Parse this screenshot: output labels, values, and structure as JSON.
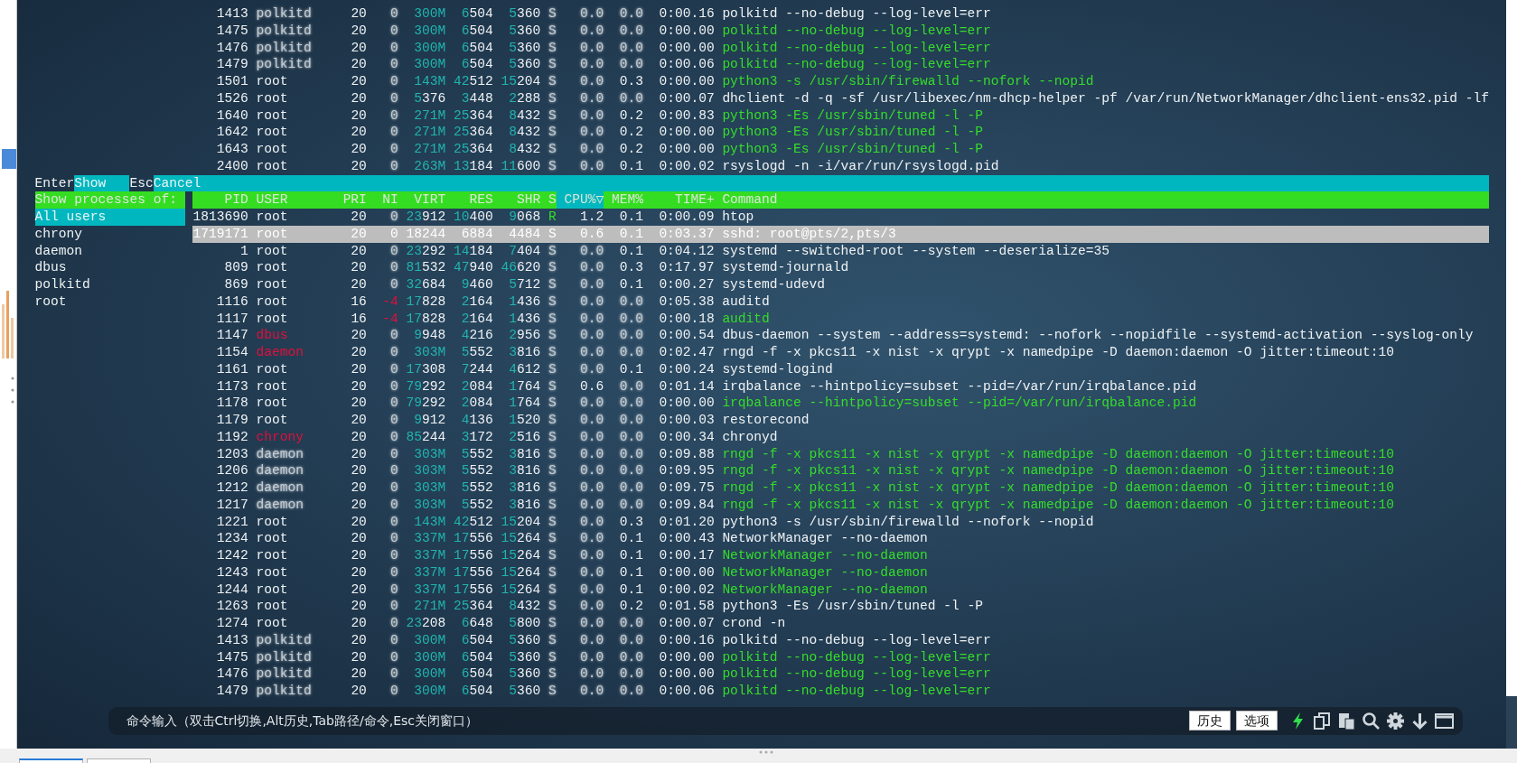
{
  "terminal": {
    "background_rows": [
      {
        "pid": "1413",
        "user": "polkitd",
        "kind": "dim",
        "pri": "20",
        "ni": "0",
        "virt": "300M",
        "res": "6504",
        "shr": "5360",
        "state": "S",
        "cpu": "0.0",
        "mem": "0.0",
        "time": "0:00.16",
        "command": "polkitd --no-debug --log-level=err",
        "thread": false
      },
      {
        "pid": "1475",
        "user": "polkitd",
        "kind": "dim",
        "pri": "20",
        "ni": "0",
        "virt": "300M",
        "res": "6504",
        "shr": "5360",
        "state": "S",
        "cpu": "0.0",
        "mem": "0.0",
        "time": "0:00.00",
        "command": "polkitd --no-debug --log-level=err",
        "thread": true
      },
      {
        "pid": "1476",
        "user": "polkitd",
        "kind": "dim",
        "pri": "20",
        "ni": "0",
        "virt": "300M",
        "res": "6504",
        "shr": "5360",
        "state": "S",
        "cpu": "0.0",
        "mem": "0.0",
        "time": "0:00.00",
        "command": "polkitd --no-debug --log-level=err",
        "thread": true
      },
      {
        "pid": "1479",
        "user": "polkitd",
        "kind": "dim",
        "pri": "20",
        "ni": "0",
        "virt": "300M",
        "res": "6504",
        "shr": "5360",
        "state": "S",
        "cpu": "0.0",
        "mem": "0.0",
        "time": "0:00.06",
        "command": "polkitd --no-debug --log-level=err",
        "thread": true
      },
      {
        "pid": "1501",
        "user": "root",
        "kind": "plain",
        "pri": "20",
        "ni": "0",
        "virt": "143M",
        "res": "42512",
        "shr": "15204",
        "state": "S",
        "cpu": "0.0",
        "mem": "0.3",
        "time": "0:00.00",
        "command": "python3 -s /usr/sbin/firewalld --nofork --nopid",
        "thread": true
      },
      {
        "pid": "1526",
        "user": "root",
        "kind": "plain",
        "pri": "20",
        "ni": "0",
        "virt": "5376",
        "res": "3448",
        "shr": "2288",
        "state": "S",
        "cpu": "0.0",
        "mem": "0.0",
        "time": "0:00.07",
        "command": "dhclient -d -q -sf /usr/libexec/nm-dhcp-helper -pf /var/run/NetworkManager/dhclient-ens32.pid -lf",
        "thread": false
      },
      {
        "pid": "1640",
        "user": "root",
        "kind": "plain",
        "pri": "20",
        "ni": "0",
        "virt": "271M",
        "res": "25364",
        "shr": "8432",
        "state": "S",
        "cpu": "0.0",
        "mem": "0.2",
        "time": "0:00.83",
        "command": "python3 -Es /usr/sbin/tuned -l -P",
        "thread": true
      },
      {
        "pid": "1642",
        "user": "root",
        "kind": "plain",
        "pri": "20",
        "ni": "0",
        "virt": "271M",
        "res": "25364",
        "shr": "8432",
        "state": "S",
        "cpu": "0.0",
        "mem": "0.2",
        "time": "0:00.00",
        "command": "python3 -Es /usr/sbin/tuned -l -P",
        "thread": true
      },
      {
        "pid": "1643",
        "user": "root",
        "kind": "plain",
        "pri": "20",
        "ni": "0",
        "virt": "271M",
        "res": "25364",
        "shr": "8432",
        "state": "S",
        "cpu": "0.0",
        "mem": "0.2",
        "time": "0:00.00",
        "command": "python3 -Es /usr/sbin/tuned -l -P",
        "thread": true
      },
      {
        "pid": "2400",
        "user": "root",
        "kind": "plain",
        "pri": "20",
        "ni": "0",
        "virt": "263M",
        "res": "13184",
        "shr": "11600",
        "state": "S",
        "cpu": "0.0",
        "mem": "0.1",
        "time": "0:00.02",
        "command": "rsyslogd -n -i/var/run/rsyslogd.pid",
        "thread": false
      }
    ],
    "function_bar": [
      {
        "key": "Enter",
        "label": "Show"
      },
      {
        "key": "Esc",
        "label": "Cancel"
      }
    ],
    "user_filter": {
      "title": "Show processes of:",
      "options": [
        {
          "label": "All users",
          "selected": true
        },
        {
          "label": "chrony",
          "selected": false
        },
        {
          "label": "daemon",
          "selected": false
        },
        {
          "label": "dbus",
          "selected": false
        },
        {
          "label": "polkitd",
          "selected": false
        },
        {
          "label": "root",
          "selected": false
        }
      ]
    },
    "process_table": {
      "columns": [
        {
          "label": "PID",
          "sorted": false
        },
        {
          "label": "USER",
          "sorted": false
        },
        {
          "label": "PRI",
          "sorted": false
        },
        {
          "label": "NI",
          "sorted": false
        },
        {
          "label": "VIRT",
          "sorted": false
        },
        {
          "label": "RES",
          "sorted": false
        },
        {
          "label": "SHR",
          "sorted": false
        },
        {
          "label": "S",
          "sorted": false
        },
        {
          "label": "CPU%▽",
          "sorted": true
        },
        {
          "label": "MEM%",
          "sorted": false
        },
        {
          "label": "TIME+",
          "sorted": false
        },
        {
          "label": "Command",
          "sorted": false
        }
      ],
      "rows": [
        {
          "pid": "1813690",
          "user": "root",
          "kind": "plain",
          "pri": "20",
          "ni": "0",
          "virt": "23912",
          "res": "10400",
          "shr": "9068",
          "state": "R",
          "cpu": "1.2",
          "mem": "0.1",
          "time": "0:00.09",
          "command": "htop",
          "thread": false,
          "selected": false
        },
        {
          "pid": "1719171",
          "user": "root",
          "kind": "plain",
          "pri": "20",
          "ni": "0",
          "virt": "18244",
          "res": "6884",
          "shr": "4484",
          "state": "S",
          "cpu": "0.6",
          "mem": "0.1",
          "time": "0:03.37",
          "command": "sshd: root@pts/2,pts/3",
          "thread": false,
          "selected": true
        },
        {
          "pid": "1",
          "user": "root",
          "kind": "plain",
          "pri": "20",
          "ni": "0",
          "virt": "23292",
          "res": "14184",
          "shr": "7404",
          "state": "S",
          "cpu": "0.0",
          "mem": "0.1",
          "time": "0:04.12",
          "command": "systemd --switched-root --system --deserialize=35",
          "thread": false,
          "selected": false
        },
        {
          "pid": "809",
          "user": "root",
          "kind": "plain",
          "pri": "20",
          "ni": "0",
          "virt": "81532",
          "res": "47940",
          "shr": "46620",
          "state": "S",
          "cpu": "0.0",
          "mem": "0.3",
          "time": "0:17.97",
          "command": "systemd-journald",
          "thread": false,
          "selected": false
        },
        {
          "pid": "869",
          "user": "root",
          "kind": "plain",
          "pri": "20",
          "ni": "0",
          "virt": "32684",
          "res": "9460",
          "shr": "5712",
          "state": "S",
          "cpu": "0.0",
          "mem": "0.1",
          "time": "0:00.27",
          "command": "systemd-udevd",
          "thread": false,
          "selected": false
        },
        {
          "pid": "1116",
          "user": "root",
          "kind": "plain",
          "pri": "16",
          "ni": "-4",
          "virt": "17828",
          "res": "2164",
          "shr": "1436",
          "state": "S",
          "cpu": "0.0",
          "mem": "0.0",
          "time": "0:05.38",
          "command": "auditd",
          "thread": false,
          "selected": false
        },
        {
          "pid": "1117",
          "user": "root",
          "kind": "plain",
          "pri": "16",
          "ni": "-4",
          "virt": "17828",
          "res": "2164",
          "shr": "1436",
          "state": "S",
          "cpu": "0.0",
          "mem": "0.0",
          "time": "0:00.18",
          "command": "auditd",
          "thread": true,
          "selected": false
        },
        {
          "pid": "1147",
          "user": "dbus",
          "kind": "alert",
          "pri": "20",
          "ni": "0",
          "virt": "9948",
          "res": "4216",
          "shr": "2956",
          "state": "S",
          "cpu": "0.0",
          "mem": "0.0",
          "time": "0:00.54",
          "command": "dbus-daemon --system --address=systemd: --nofork --nopidfile --systemd-activation --syslog-only",
          "thread": false,
          "selected": false
        },
        {
          "pid": "1154",
          "user": "daemon",
          "kind": "alert",
          "pri": "20",
          "ni": "0",
          "virt": "303M",
          "res": "5552",
          "shr": "3816",
          "state": "S",
          "cpu": "0.0",
          "mem": "0.0",
          "time": "0:02.47",
          "command": "rngd -f -x pkcs11 -x nist -x qrypt -x namedpipe -D daemon:daemon -O jitter:timeout:10",
          "thread": false,
          "selected": false
        },
        {
          "pid": "1161",
          "user": "root",
          "kind": "plain",
          "pri": "20",
          "ni": "0",
          "virt": "17308",
          "res": "7244",
          "shr": "4612",
          "state": "S",
          "cpu": "0.0",
          "mem": "0.1",
          "time": "0:00.24",
          "command": "systemd-logind",
          "thread": false,
          "selected": false
        },
        {
          "pid": "1173",
          "user": "root",
          "kind": "plain",
          "pri": "20",
          "ni": "0",
          "virt": "79292",
          "res": "2084",
          "shr": "1764",
          "state": "S",
          "cpu": "0.6",
          "mem": "0.0",
          "time": "0:01.14",
          "command": "irqbalance --hintpolicy=subset --pid=/var/run/irqbalance.pid",
          "thread": false,
          "selected": false
        },
        {
          "pid": "1178",
          "user": "root",
          "kind": "plain",
          "pri": "20",
          "ni": "0",
          "virt": "79292",
          "res": "2084",
          "shr": "1764",
          "state": "S",
          "cpu": "0.0",
          "mem": "0.0",
          "time": "0:00.00",
          "command": "irqbalance --hintpolicy=subset --pid=/var/run/irqbalance.pid",
          "thread": true,
          "selected": false
        },
        {
          "pid": "1179",
          "user": "root",
          "kind": "plain",
          "pri": "20",
          "ni": "0",
          "virt": "9912",
          "res": "4136",
          "shr": "1520",
          "state": "S",
          "cpu": "0.0",
          "mem": "0.0",
          "time": "0:00.03",
          "command": "restorecond",
          "thread": false,
          "selected": false
        },
        {
          "pid": "1192",
          "user": "chrony",
          "kind": "alert",
          "pri": "20",
          "ni": "0",
          "virt": "85244",
          "res": "3172",
          "shr": "2516",
          "state": "S",
          "cpu": "0.0",
          "mem": "0.0",
          "time": "0:00.34",
          "command": "chronyd",
          "thread": false,
          "selected": false
        },
        {
          "pid": "1203",
          "user": "daemon",
          "kind": "dim",
          "pri": "20",
          "ni": "0",
          "virt": "303M",
          "res": "5552",
          "shr": "3816",
          "state": "S",
          "cpu": "0.0",
          "mem": "0.0",
          "time": "0:09.88",
          "command": "rngd -f -x pkcs11 -x nist -x qrypt -x namedpipe -D daemon:daemon -O jitter:timeout:10",
          "thread": true,
          "selected": false
        },
        {
          "pid": "1206",
          "user": "daemon",
          "kind": "dim",
          "pri": "20",
          "ni": "0",
          "virt": "303M",
          "res": "5552",
          "shr": "3816",
          "state": "S",
          "cpu": "0.0",
          "mem": "0.0",
          "time": "0:09.95",
          "command": "rngd -f -x pkcs11 -x nist -x qrypt -x namedpipe -D daemon:daemon -O jitter:timeout:10",
          "thread": true,
          "selected": false
        },
        {
          "pid": "1212",
          "user": "daemon",
          "kind": "dim",
          "pri": "20",
          "ni": "0",
          "virt": "303M",
          "res": "5552",
          "shr": "3816",
          "state": "S",
          "cpu": "0.0",
          "mem": "0.0",
          "time": "0:09.75",
          "command": "rngd -f -x pkcs11 -x nist -x qrypt -x namedpipe -D daemon:daemon -O jitter:timeout:10",
          "thread": true,
          "selected": false
        },
        {
          "pid": "1217",
          "user": "daemon",
          "kind": "dim",
          "pri": "20",
          "ni": "0",
          "virt": "303M",
          "res": "5552",
          "shr": "3816",
          "state": "S",
          "cpu": "0.0",
          "mem": "0.0",
          "time": "0:09.84",
          "command": "rngd -f -x pkcs11 -x nist -x qrypt -x namedpipe -D daemon:daemon -O jitter:timeout:10",
          "thread": true,
          "selected": false
        },
        {
          "pid": "1221",
          "user": "root",
          "kind": "plain",
          "pri": "20",
          "ni": "0",
          "virt": "143M",
          "res": "42512",
          "shr": "15204",
          "state": "S",
          "cpu": "0.0",
          "mem": "0.3",
          "time": "0:01.20",
          "command": "python3 -s /usr/sbin/firewalld --nofork --nopid",
          "thread": false,
          "selected": false
        },
        {
          "pid": "1234",
          "user": "root",
          "kind": "plain",
          "pri": "20",
          "ni": "0",
          "virt": "337M",
          "res": "17556",
          "shr": "15264",
          "state": "S",
          "cpu": "0.0",
          "mem": "0.1",
          "time": "0:00.43",
          "command": "NetworkManager --no-daemon",
          "thread": false,
          "selected": false
        },
        {
          "pid": "1242",
          "user": "root",
          "kind": "plain",
          "pri": "20",
          "ni": "0",
          "virt": "337M",
          "res": "17556",
          "shr": "15264",
          "state": "S",
          "cpu": "0.0",
          "mem": "0.1",
          "time": "0:00.17",
          "command": "NetworkManager --no-daemon",
          "thread": true,
          "selected": false
        },
        {
          "pid": "1243",
          "user": "root",
          "kind": "plain",
          "pri": "20",
          "ni": "0",
          "virt": "337M",
          "res": "17556",
          "shr": "15264",
          "state": "S",
          "cpu": "0.0",
          "mem": "0.1",
          "time": "0:00.00",
          "command": "NetworkManager --no-daemon",
          "thread": true,
          "selected": false
        },
        {
          "pid": "1244",
          "user": "root",
          "kind": "plain",
          "pri": "20",
          "ni": "0",
          "virt": "337M",
          "res": "17556",
          "shr": "15264",
          "state": "S",
          "cpu": "0.0",
          "mem": "0.1",
          "time": "0:00.02",
          "command": "NetworkManager --no-daemon",
          "thread": true,
          "selected": false
        },
        {
          "pid": "1263",
          "user": "root",
          "kind": "plain",
          "pri": "20",
          "ni": "0",
          "virt": "271M",
          "res": "25364",
          "shr": "8432",
          "state": "S",
          "cpu": "0.0",
          "mem": "0.2",
          "time": "0:01.58",
          "command": "python3 -Es /usr/sbin/tuned -l -P",
          "thread": false,
          "selected": false
        },
        {
          "pid": "1274",
          "user": "root",
          "kind": "plain",
          "pri": "20",
          "ni": "0",
          "virt": "23208",
          "res": "6648",
          "shr": "5800",
          "state": "S",
          "cpu": "0.0",
          "mem": "0.0",
          "time": "0:00.07",
          "command": "crond -n",
          "thread": false,
          "selected": false
        },
        {
          "pid": "1413",
          "user": "polkitd",
          "kind": "dim",
          "pri": "20",
          "ni": "0",
          "virt": "300M",
          "res": "6504",
          "shr": "5360",
          "state": "S",
          "cpu": "0.0",
          "mem": "0.0",
          "time": "0:00.16",
          "command": "polkitd --no-debug --log-level=err",
          "thread": false,
          "selected": false
        },
        {
          "pid": "1475",
          "user": "polkitd",
          "kind": "dim",
          "pri": "20",
          "ni": "0",
          "virt": "300M",
          "res": "6504",
          "shr": "5360",
          "state": "S",
          "cpu": "0.0",
          "mem": "0.0",
          "time": "0:00.00",
          "command": "polkitd --no-debug --log-level=err",
          "thread": true,
          "selected": false
        },
        {
          "pid": "1476",
          "user": "polkitd",
          "kind": "dim",
          "pri": "20",
          "ni": "0",
          "virt": "300M",
          "res": "6504",
          "shr": "5360",
          "state": "S",
          "cpu": "0.0",
          "mem": "0.0",
          "time": "0:00.00",
          "command": "polkitd --no-debug --log-level=err",
          "thread": true,
          "selected": false
        },
        {
          "pid": "1479",
          "user": "polkitd",
          "kind": "dim",
          "pri": "20",
          "ni": "0",
          "virt": "300M",
          "res": "6504",
          "shr": "5360",
          "state": "S",
          "cpu": "0.0",
          "mem": "0.0",
          "time": "0:00.06",
          "command": "polkitd --no-debug --log-level=err",
          "thread": true,
          "selected": false
        }
      ]
    }
  },
  "command_bar": {
    "placeholder": "命令输入（双击Ctrl切换,Alt历史,Tab路径/命令,Esc关闭窗口）",
    "buttons": [
      "历史",
      "选项"
    ]
  }
}
